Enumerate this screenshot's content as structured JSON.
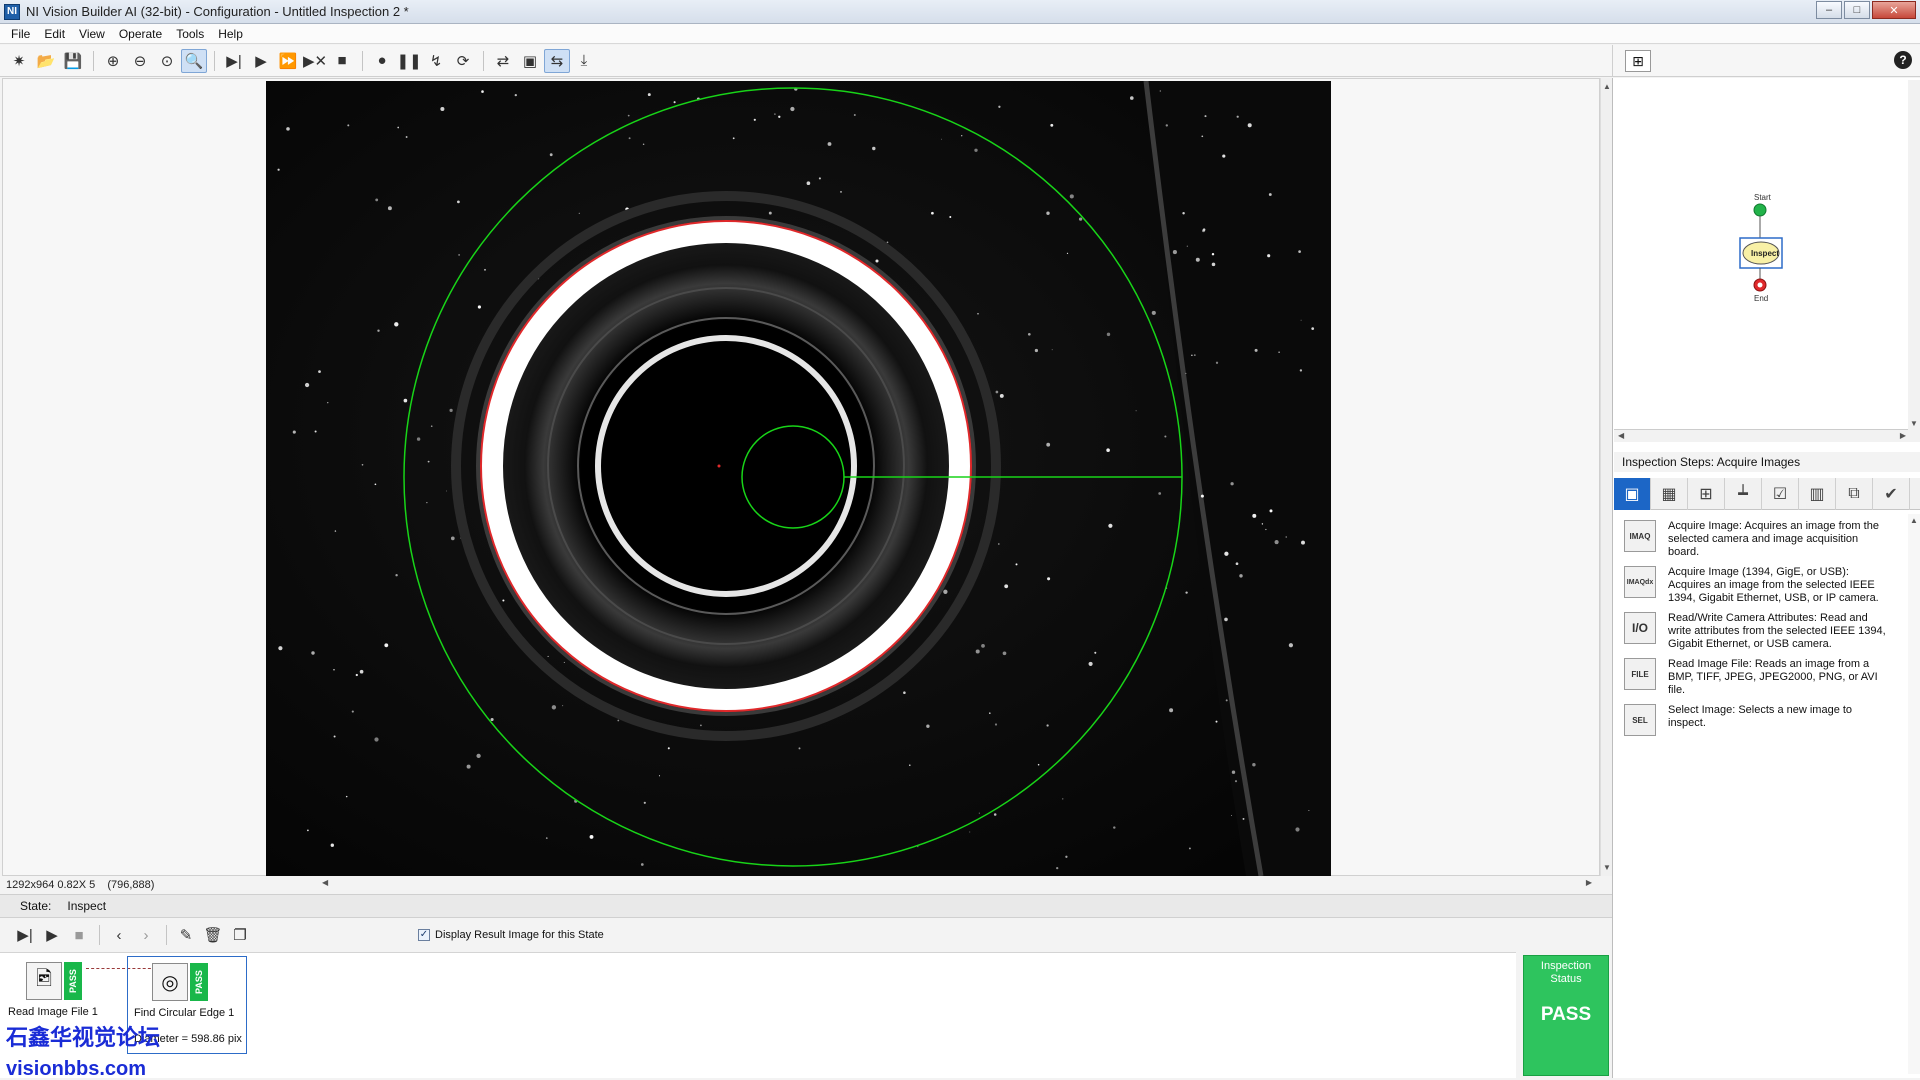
{
  "window": {
    "title": "NI Vision Builder AI (32-bit) - Configuration - Untitled Inspection 2 *",
    "app_icon": "NI"
  },
  "menu": [
    "File",
    "Edit",
    "View",
    "Operate",
    "Tools",
    "Help"
  ],
  "toolbar_icons": {
    "new": "✷",
    "open": "📂",
    "save": "💾",
    "zoom_in": "⊕",
    "zoom_out": "⊖",
    "zoom_fit": "⊙",
    "zoom_window": "🔍",
    "run_step": "▶|",
    "run": "▶",
    "run_loop": "⏩",
    "run_x": "▶✕",
    "stop": "■",
    "breakpoint": "●",
    "pause": "❚❚",
    "step_a": "↯",
    "step_b": "⟳",
    "img_a": "⇄",
    "img_b": "▣",
    "img_c": "⇆",
    "img_d": "⤓"
  },
  "help_label": "?",
  "viewer": {
    "status": "1292x964 0.82X 5",
    "cursor": "(796,888)"
  },
  "state_bar": {
    "label": "State:",
    "value": "Inspect"
  },
  "insp_toolbar": {
    "display_result_label": "Display Result Image for this State",
    "display_result_checked": "✓"
  },
  "steps": [
    {
      "label": "Read Image File 1",
      "result": "",
      "status": "PASS"
    },
    {
      "label": "Find Circular Edge 1",
      "result": "Diameter = 598.86 pix",
      "status": "PASS"
    }
  ],
  "inspection_status": {
    "title": "Inspection Status",
    "value": "PASS"
  },
  "watermark": {
    "cn": "石鑫华视觉论坛",
    "url": "visionbbs.com"
  },
  "state_diagram": {
    "start": "Start",
    "inspect": "Inspect",
    "end": "End"
  },
  "steps_palette": {
    "title": "Inspection Steps: Acquire Images",
    "items": [
      {
        "icon": "IMAQ",
        "text": "Acquire Image:  Acquires an image from the selected camera and image acquisition board."
      },
      {
        "icon": "IMAQdx",
        "text": "Acquire Image (1394, GigE, or USB):  Acquires an image from the selected IEEE 1394, Gigabit Ethernet, USB, or IP camera."
      },
      {
        "icon": "I/O",
        "text": "Read/Write Camera Attributes:  Read and write attributes from the selected IEEE 1394, Gigabit Ethernet, or USB camera."
      },
      {
        "icon": "FILE",
        "text": "Read Image File:  Reads an image from a BMP, TIFF, JPEG, JPEG2000, PNG, or AVI file."
      },
      {
        "icon": "SEL",
        "text": "Select Image:  Selects a new image to inspect."
      }
    ]
  },
  "colors": {
    "pass_green": "#2ec45e",
    "roi_green": "#18d418",
    "edge_red": "#e0292b",
    "accent_blue": "#1c66c6"
  }
}
